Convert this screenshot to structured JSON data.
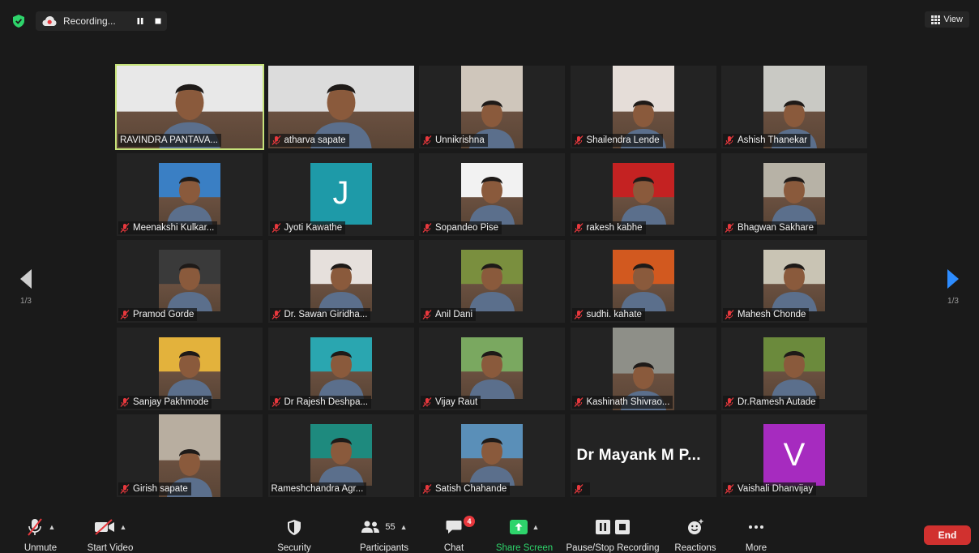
{
  "topbar": {
    "recording_label": "Recording...",
    "view_label": "View"
  },
  "pager": {
    "left_page": "1/3",
    "right_page": "1/3"
  },
  "participants": [
    {
      "name": "RAVINDRA PANTAVA...",
      "muted": false,
      "active": true,
      "kind": "photo",
      "bg": "#e8e8e8"
    },
    {
      "name": "atharva sapate",
      "muted": true,
      "kind": "wide",
      "bg": "#dcdcdc"
    },
    {
      "name": "Unnikrishna",
      "muted": true,
      "kind": "photo",
      "bg": "#cfc6bb"
    },
    {
      "name": "Shailendra Lende",
      "muted": true,
      "kind": "photo",
      "bg": "#e5ddd8"
    },
    {
      "name": "Ashish Thanekar",
      "muted": true,
      "kind": "photo",
      "bg": "#c9c9c4"
    },
    {
      "name": "Meenakshi Kulkar...",
      "muted": true,
      "kind": "square",
      "bg": "#3a7fc4"
    },
    {
      "name": "Jyoti Kawathe",
      "muted": true,
      "kind": "letter",
      "letter": "J",
      "bg": "#1e9aa8"
    },
    {
      "name": "Sopandeo Pise",
      "muted": true,
      "kind": "square",
      "bg": "#f2f2f2"
    },
    {
      "name": "rakesh kabhe",
      "muted": true,
      "kind": "square",
      "bg": "#c42222"
    },
    {
      "name": "Bhagwan Sakhare",
      "muted": true,
      "kind": "square",
      "bg": "#b7b2a6"
    },
    {
      "name": "Pramod Gorde",
      "muted": true,
      "kind": "square",
      "bg": "#3a3a3a"
    },
    {
      "name": "Dr. Sawan Giridha...",
      "muted": true,
      "kind": "square",
      "bg": "#e6e0dc"
    },
    {
      "name": "Anil Dani",
      "muted": true,
      "kind": "square",
      "bg": "#7a8f3e"
    },
    {
      "name": "sudhi. kahate",
      "muted": true,
      "kind": "square",
      "bg": "#d2591f"
    },
    {
      "name": "Mahesh Chonde",
      "muted": true,
      "kind": "square",
      "bg": "#c9c4b4"
    },
    {
      "name": "Sanjay Pakhmode",
      "muted": true,
      "kind": "square",
      "bg": "#e3b23c"
    },
    {
      "name": "Dr Rajesh Deshpa...",
      "muted": true,
      "kind": "square",
      "bg": "#2aa6b0"
    },
    {
      "name": "Vijay Raut",
      "muted": true,
      "kind": "square",
      "bg": "#7aa860"
    },
    {
      "name": "Kashinath Shivrao...",
      "muted": true,
      "kind": "photo",
      "bg": "#8e8f88"
    },
    {
      "name": "Dr.Ramesh Autade",
      "muted": true,
      "kind": "square",
      "bg": "#6b8a3c"
    },
    {
      "name": "Girish sapate",
      "muted": true,
      "kind": "photo",
      "bg": "#b8aea0"
    },
    {
      "name": "Rameshchandra Agr...",
      "muted": false,
      "kind": "square",
      "bg": "#1e8a7e"
    },
    {
      "name": "Satish Chahande",
      "muted": true,
      "kind": "square",
      "bg": "#5a8fb8"
    },
    {
      "name": "",
      "muted": true,
      "kind": "bigname",
      "bigname": "Dr Mayank M P...",
      "bg": "#232323"
    },
    {
      "name": "Vaishali Dhanvijay",
      "muted": true,
      "kind": "letter",
      "letter": "V",
      "bg": "#a62bbf"
    }
  ],
  "toolbar": {
    "unmute": "Unmute",
    "start_video": "Start Video",
    "security": "Security",
    "participants_count": "55",
    "participants": "Participants",
    "chat_badge": "4",
    "chat": "Chat",
    "share_screen": "Share Screen",
    "pause_stop_recording": "Pause/Stop Recording",
    "reactions": "Reactions",
    "more": "More",
    "end": "End"
  },
  "colors": {
    "active_speaker_border": "#c6e27a",
    "muted_mic": "#e8383d",
    "share_green": "#2ed46b",
    "end_red": "#d1312f",
    "right_arrow": "#2d8cff"
  }
}
